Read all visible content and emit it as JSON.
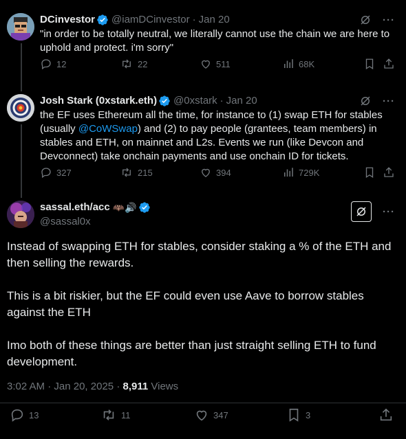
{
  "tweet1": {
    "name": "DCinvestor",
    "handle": "@iamDCinvestor",
    "date": "Jan 20",
    "text": "\"in order to be totally neutral, we literally cannot use the chain we are here to uphold and protect. i'm sorry\"",
    "replies": "12",
    "retweets": "22",
    "likes": "511",
    "views": "68K"
  },
  "tweet2": {
    "name": "Josh Stark (0xstark.eth)",
    "handle": "@0xstark",
    "date": "Jan 20",
    "text_before_link": "the EF uses Ethereum all the time, for instance to (1) swap ETH for stables (usually ",
    "link": "@CoWSwap",
    "text_after_link": ") and (2) to pay people (grantees, team members) in stables and ETH, on mainnet and L2s. Events we run (like Devcon and Devconnect) take onchain payments and use onchain ID for tickets.",
    "replies": "327",
    "retweets": "215",
    "likes": "394",
    "views": "729K"
  },
  "tweet3": {
    "name": "sassal.eth/acc",
    "name_emoji": "🦇🔊",
    "handle": "@sassal0x",
    "paragraphs": [
      "Instead of swapping ETH for stables, consider staking a % of the ETH and then selling the rewards.",
      "This is a bit riskier, but the EF could even use Aave to borrow stables against the ETH",
      "Imo both of these things are better than just straight selling ETH to fund development."
    ],
    "time": "3:02 AM",
    "date": "Jan 20, 2025",
    "views_count": "8,911",
    "views_label": "Views",
    "replies": "13",
    "retweets": "11",
    "likes": "347",
    "bookmarks": "3"
  },
  "colors": {
    "background": "#000000",
    "text": "#e7e9ea",
    "muted": "#71767b",
    "link": "#1d9bf0",
    "verified": "#1d9bf0"
  },
  "icons": [
    "verified-badge-icon",
    "grok-icon",
    "more-icon",
    "reply-icon",
    "retweet-icon",
    "like-icon",
    "views-icon",
    "bookmark-icon",
    "share-icon"
  ]
}
